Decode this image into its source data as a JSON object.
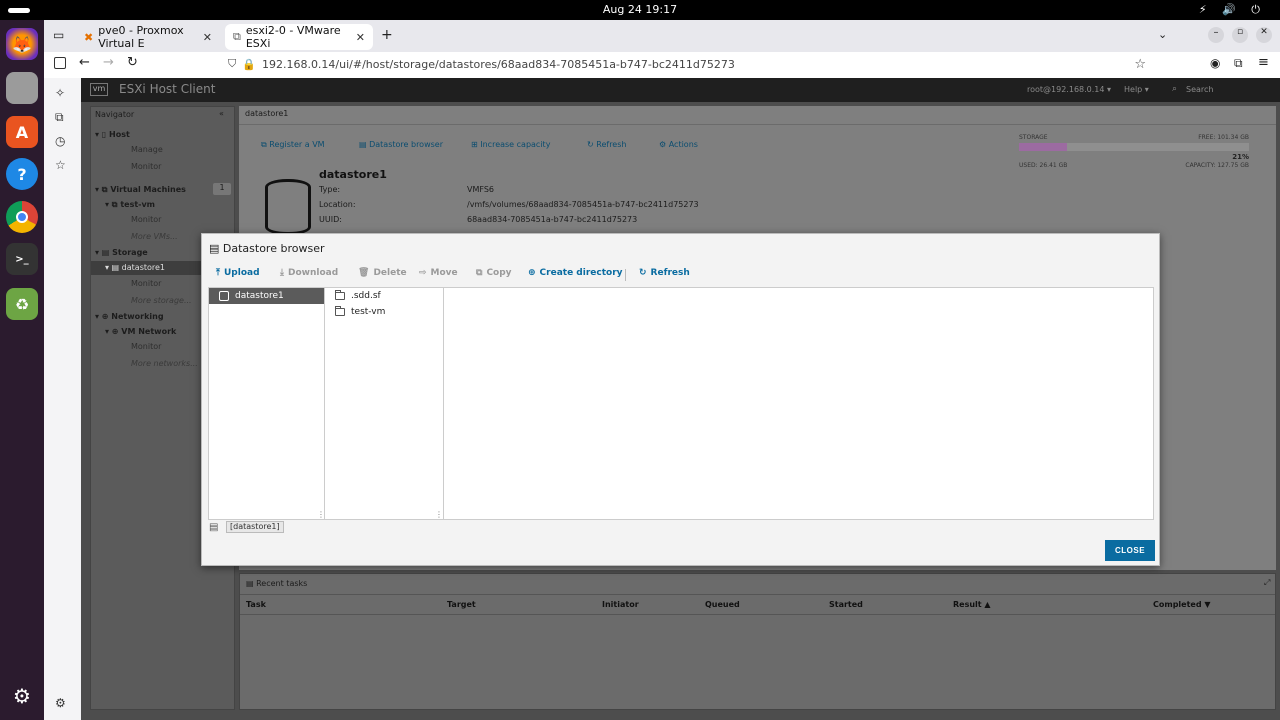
{
  "system": {
    "clock": "Aug 24  19:17",
    "status_icons": "⚡ 🔊 ⏻"
  },
  "browser": {
    "tabs": [
      {
        "title": "pve0 - Proxmox Virtual E"
      },
      {
        "title": "esxi2-0 - VMware ESXi"
      }
    ],
    "url": "192.168.0.14/ui/#/host/storage/datastores/68aad834-7085451a-b747-bc2411d75273"
  },
  "esxi": {
    "logo": "vm",
    "title": "ESXi Host Client",
    "user": "root@192.168.0.14 ▾",
    "help": "Help ▾",
    "search_placeholder": "Search"
  },
  "navigator": {
    "title": "Navigator",
    "host": "Host",
    "host_manage": "Manage",
    "host_monitor": "Monitor",
    "vms": "Virtual Machines",
    "vms_count": "1",
    "vm_name": "test-vm",
    "vm_monitor": "Monitor",
    "more_vms": "More VMs...",
    "storage": "Storage",
    "datastore": "datastore1",
    "storage_monitor": "Monitor",
    "more_storage": "More storage...",
    "networking": "Networking",
    "vm_network": "VM Network",
    "net_monitor": "Monitor",
    "more_networks": "More networks..."
  },
  "main": {
    "breadcrumb": "datastore1",
    "actions": [
      "Register a VM",
      "Datastore browser",
      "Increase capacity",
      "Refresh",
      "Actions"
    ],
    "ds_name": "datastore1",
    "type_label": "Type:",
    "type_value": "VMFS6",
    "location_label": "Location:",
    "location_value": "/vmfs/volumes/68aad834-7085451a-b747-bc2411d75273",
    "uuid_label": "UUID:",
    "uuid_value": "68aad834-7085451a-b747-bc2411d75273",
    "storage_label": "STORAGE",
    "free": "FREE: 101.34 GB",
    "percent_text": "21%",
    "used_fraction": 0.21,
    "used": "USED: 26.41 GB",
    "capacity": "CAPACITY: 127.75 GB"
  },
  "tasks": {
    "title": "Recent tasks",
    "columns": [
      "Task",
      "Target",
      "Initiator",
      "Queued",
      "Started",
      "Result ▲",
      "Completed ▼"
    ]
  },
  "modal": {
    "title": "Datastore browser",
    "toolbar": {
      "upload": "Upload",
      "download": "Download",
      "delete": "Delete",
      "move": "Move",
      "copy": "Copy",
      "create_directory": "Create directory",
      "refresh": "Refresh"
    },
    "datastore_item": "datastore1",
    "folders": [
      ".sdd.sf",
      "test-vm"
    ],
    "path": "[datastore1]",
    "close": "CLOSE"
  },
  "colors": {
    "accent": "#0a6ca1",
    "selected_row": "#5b5b5b",
    "usage_bar": "#c98bd0"
  }
}
